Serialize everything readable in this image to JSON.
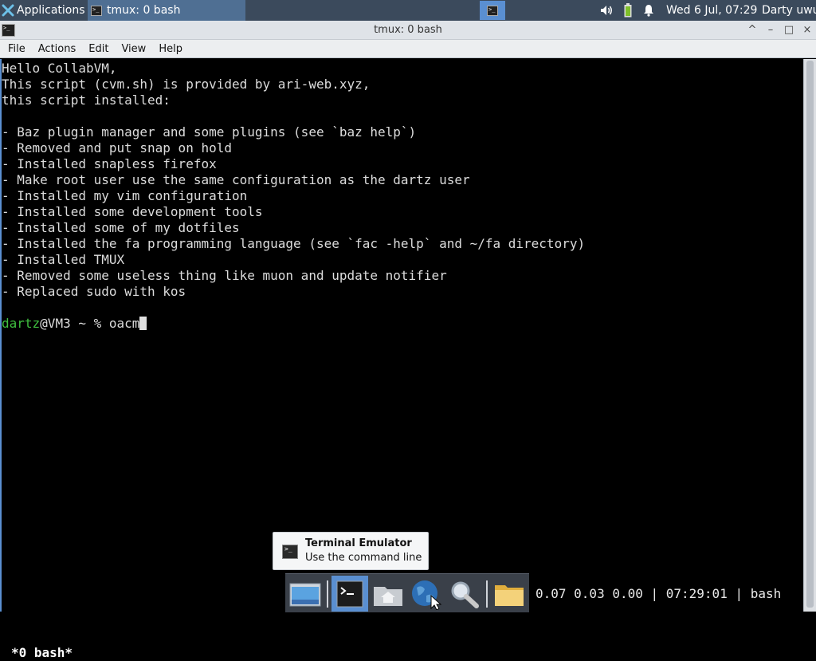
{
  "top_panel": {
    "applications_label": "Applications",
    "task_label": "tmux: 0 bash",
    "clock": "Wed  6 Jul, 07:29",
    "user": "Darty uwu",
    "icons": [
      "volume-icon",
      "battery-icon",
      "notification-bell-icon"
    ]
  },
  "window": {
    "title": "tmux: 0 bash",
    "controls": [
      "^",
      "–",
      "□",
      "×"
    ]
  },
  "menubar": {
    "items": [
      "File",
      "Actions",
      "Edit",
      "View",
      "Help"
    ]
  },
  "terminal": {
    "lines": [
      "Hello CollabVM,",
      "This script (cvm.sh) is provided by ari-web.xyz,",
      "this script installed:",
      "",
      "- Baz plugin manager and some plugins (see `baz help`)",
      "- Removed and put snap on hold",
      "- Installed snapless firefox",
      "- Make root user use the same configuration as the dartz user",
      "- Installed my vim configuration",
      "- Installed some development tools",
      "- Installed some of my dotfiles",
      "- Installed the fa programming language (see `fac -help` and ~/fa directory)",
      "- Installed TMUX",
      "- Removed some useless thing like muon and update notifier",
      "- Replaced sudo with kos",
      ""
    ],
    "prompt_user": "dartz",
    "prompt_rest": "@VM3 ~ % ",
    "command": "oacm"
  },
  "tmux_status": {
    "left": "*0 bash*",
    "right": "0.07 0.03 0.00 | 07:29:01 | bash"
  },
  "tooltip": {
    "title": "Terminal Emulator",
    "subtitle": "Use the command line"
  },
  "dock": {
    "items": [
      "show-desktop",
      "terminal",
      "home-folder",
      "web-browser",
      "app-finder",
      "files"
    ]
  },
  "colors": {
    "panel_bg": "#3b4a5c",
    "accent": "#5a8fd1",
    "prompt_user": "#3fbf3f",
    "terminal_bg": "#000000"
  }
}
